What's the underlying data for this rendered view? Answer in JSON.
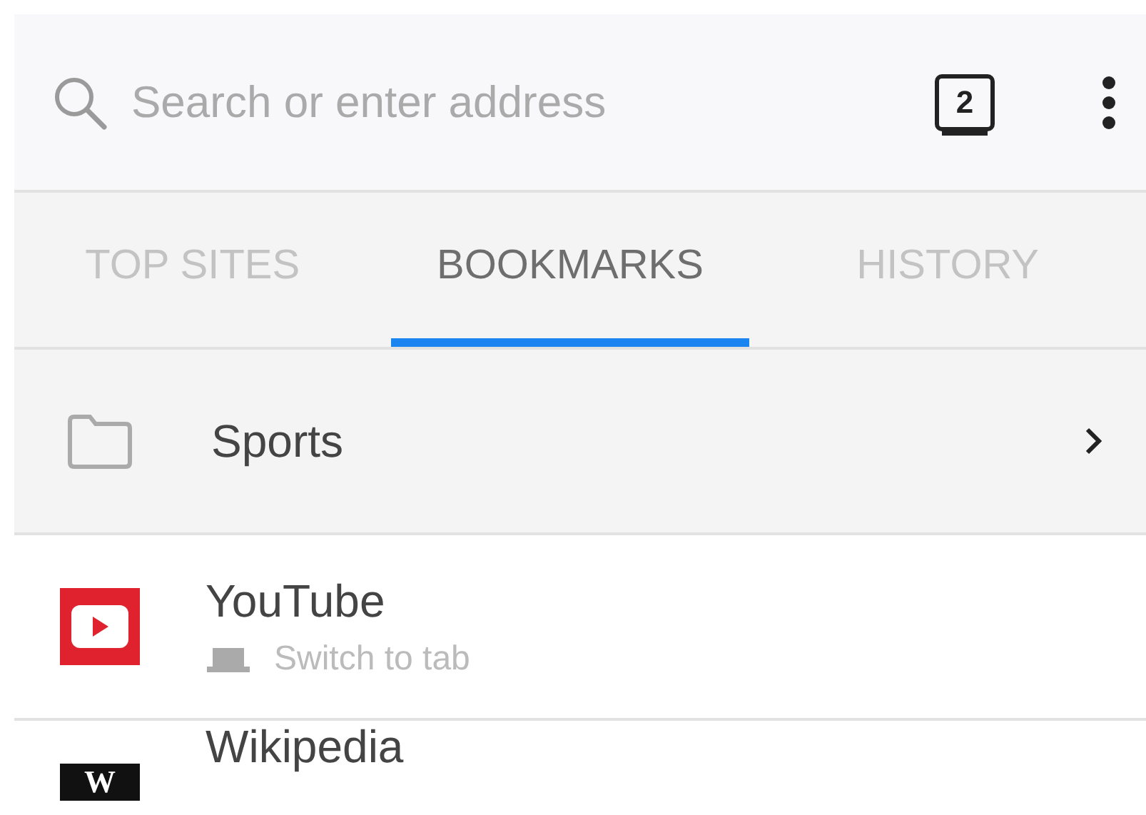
{
  "toolbar": {
    "search": {
      "placeholder": "Search or enter address"
    },
    "tab_count": "2"
  },
  "tabs": [
    {
      "label": "TOP SITES",
      "selected": false
    },
    {
      "label": "BOOKMARKS",
      "selected": true
    },
    {
      "label": "HISTORY",
      "selected": false
    }
  ],
  "items": [
    {
      "kind": "folder",
      "title": "Sports"
    },
    {
      "kind": "video",
      "title": "YouTube",
      "subtitle": "Switch to tab"
    },
    {
      "kind": "wiki",
      "logo_letter": "W",
      "title": "Wikipedia"
    }
  ]
}
